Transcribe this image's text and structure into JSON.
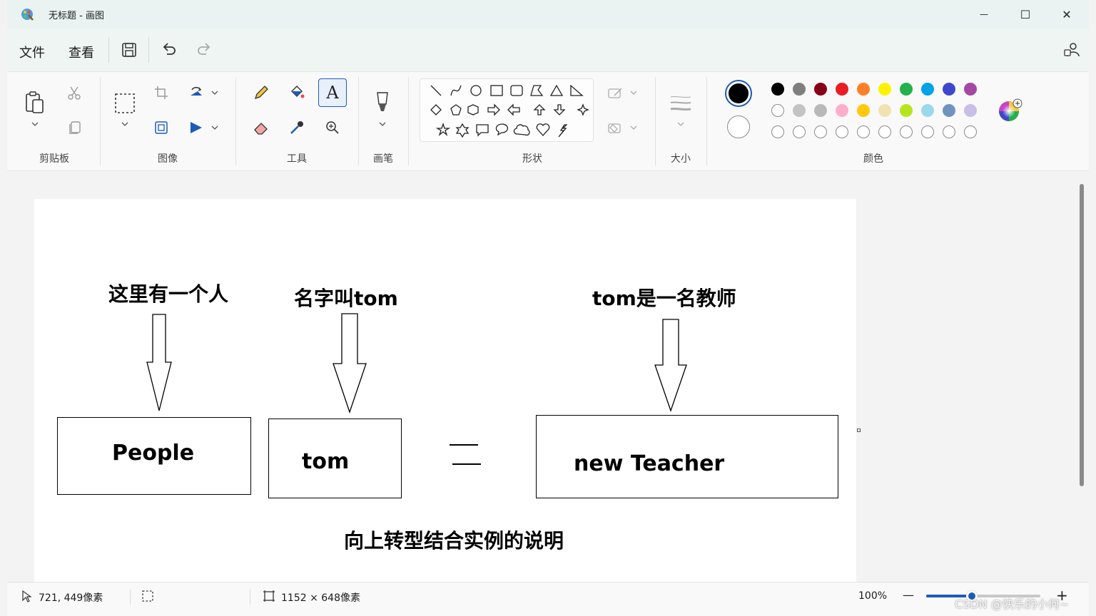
{
  "window": {
    "title": "无标题 - 画图",
    "minimize_glyph": "—",
    "maximize_glyph": "☐",
    "close_glyph": "✕"
  },
  "menu": {
    "file": "文件",
    "view": "查看"
  },
  "ribbon": {
    "groups": {
      "clipboard": "剪贴板",
      "image": "图像",
      "tools": "工具",
      "brushes": "画笔",
      "shapes": "形状",
      "size": "大小",
      "colors": "颜色"
    },
    "text_tool_glyph": "A",
    "palette_row1": [
      "#000000",
      "#7f7f7f",
      "#880015",
      "#ed1c24",
      "#ff7f27",
      "#fff200",
      "#22b14c",
      "#00a2e8",
      "#3f48cc",
      "#a349a4"
    ],
    "palette_row2": [
      "#ffffff",
      "#c3c3c3",
      "#b9b9b9",
      "#ffaec9",
      "#ffc90e",
      "#efe4b0",
      "#b5e61d",
      "#99d9ea",
      "#7092be",
      "#c8bfe7"
    ],
    "primary_color": "#000000",
    "secondary_color": "#ffffff"
  },
  "canvas": {
    "label_person": "这里有一个人",
    "label_name": "名字叫tom",
    "label_teacher": "tom是一名教师",
    "box_people": "People",
    "box_tom": "tom",
    "box_teacher": "new Teacher",
    "caption": "向上转型结合实例的说明"
  },
  "status": {
    "cursor_pos": "721, 449像素",
    "canvas_size": "1152 × 648像素",
    "zoom": "100%",
    "zoom_out": "—",
    "zoom_in": "+"
  },
  "watermark": "CSDN @快乐的小何~"
}
